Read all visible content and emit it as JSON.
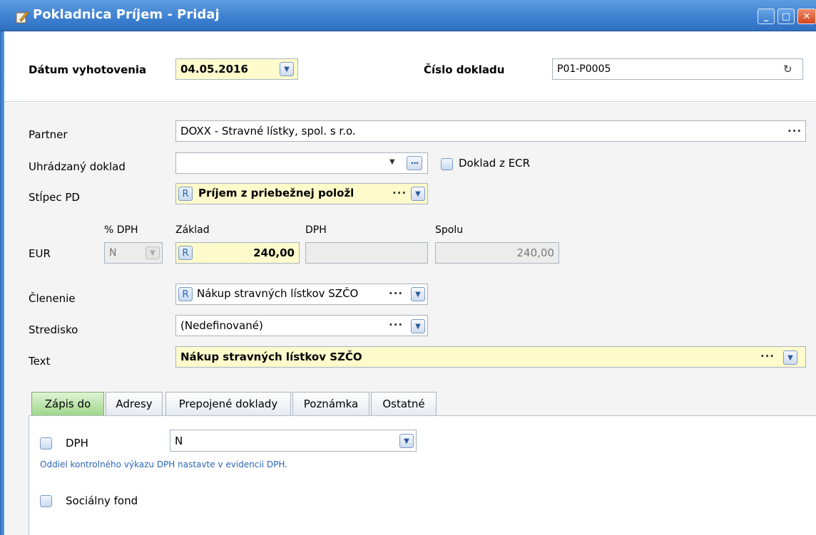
{
  "window": {
    "title": "Pokladnica Príjem - Pridaj",
    "minimize_label": "_",
    "maximize_label": "□",
    "close_label": "✕"
  },
  "header": {
    "date_label": "Dátum vyhotovenia",
    "date_value": "04.05.2016",
    "doc_number_label": "Číslo dokladu",
    "doc_number_value": "P01-P0005",
    "refresh_icon": "↻"
  },
  "form": {
    "partner_label": "Partner",
    "partner_value": "DOXX - Stravné lístky, spol. s r.o.",
    "paid_doc_label": "Uhrádzaný doklad",
    "paid_doc_value": "",
    "ecr_label": "Doklad z ECR",
    "column_label": "Stĺpec PD",
    "column_value": "Príjem z priebežnej položl",
    "currency_label": "EUR",
    "vat_pct_header": "% DPH",
    "vat_pct_value": "N",
    "base_header": "Základ",
    "base_value": "240,00",
    "vat_header": "DPH",
    "vat_value": "",
    "total_header": "Spolu",
    "total_value": "240,00",
    "division_label": "Členenie",
    "division_value": "Nákup stravných lístkov SZČO",
    "center_label": "Stredisko",
    "center_value": "(Nedefinované)",
    "text_label": "Text",
    "text_value": "Nákup stravných lístkov SZČO",
    "r_label": "R",
    "dots": "···"
  },
  "tabs": [
    {
      "label": "Zápis do"
    },
    {
      "label": "Adresy"
    },
    {
      "label": "Prepojené doklady"
    },
    {
      "label": "Poznámka"
    },
    {
      "label": "Ostatné"
    }
  ],
  "panel": {
    "vat_label": "DPH",
    "vat_select_value": "N",
    "vat_hint": "Oddiel kontrolného výkazu DPH nastavte v evidencii DPH.",
    "social_fund_label": "Sociálny fond"
  },
  "colors": {
    "titlebar": "#3d80d0",
    "highlight_field": "#fffbcc",
    "active_tab": "#9fd68a",
    "hint_text": "#2b66b5"
  }
}
